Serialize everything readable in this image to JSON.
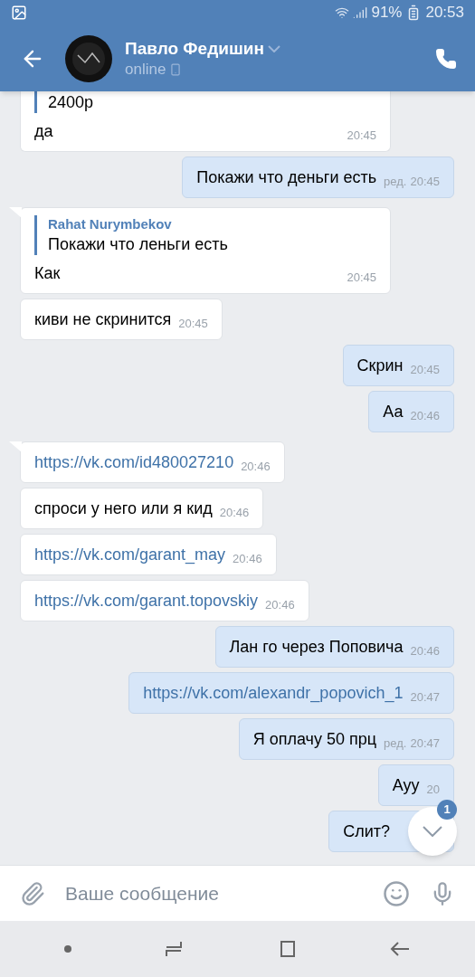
{
  "status_bar": {
    "battery": "91%",
    "time": "20:53"
  },
  "header": {
    "name": "Павло Федишин",
    "status": "online"
  },
  "messages": [
    {
      "outgoing": false,
      "tail": false,
      "quote": {
        "text": "2400р"
      },
      "kind": "text",
      "text": "да",
      "time": "20:45"
    },
    {
      "outgoing": true,
      "tail": false,
      "kind": "text",
      "text": "Покажи что деньги есть",
      "edited": "ред.",
      "time": "20:45"
    },
    {
      "outgoing": false,
      "tail": true,
      "quote": {
        "author": "Rahat Nurymbekov",
        "text": "Покажи что леньги есть"
      },
      "kind": "text",
      "text": "Как",
      "time": "20:45"
    },
    {
      "outgoing": false,
      "tail": false,
      "kind": "text",
      "text": "киви не скринится",
      "time": "20:45"
    },
    {
      "outgoing": true,
      "tail": false,
      "kind": "text",
      "text": "Скрин",
      "time": "20:45"
    },
    {
      "outgoing": true,
      "tail": false,
      "kind": "text",
      "text": "Аа",
      "time": "20:46"
    },
    {
      "outgoing": false,
      "tail": true,
      "kind": "link",
      "text": "https://vk.com/id480027210",
      "time": "20:46"
    },
    {
      "outgoing": false,
      "tail": false,
      "kind": "text",
      "text": "спроси у него или я кид",
      "time": "20:46"
    },
    {
      "outgoing": false,
      "tail": false,
      "kind": "link",
      "text": "https://vk.com/garant_may",
      "time": "20:46"
    },
    {
      "outgoing": false,
      "tail": false,
      "kind": "link",
      "text": "https://vk.com/garant.topovskiy",
      "time": "20:46"
    },
    {
      "outgoing": true,
      "tail": false,
      "kind": "text",
      "text": "Лан го через Поповича",
      "time": "20:46"
    },
    {
      "outgoing": true,
      "tail": false,
      "kind": "link",
      "text": "https://vk.com/alexandr_popovich_1",
      "time": "20:47"
    },
    {
      "outgoing": true,
      "tail": false,
      "kind": "text",
      "text": "Я оплачу 50 прц",
      "edited": "ред.",
      "time": "20:47"
    },
    {
      "outgoing": true,
      "tail": false,
      "kind": "text",
      "text": "Ауу",
      "time": "20"
    },
    {
      "outgoing": true,
      "tail": false,
      "kind": "text",
      "text": "Слит?"
    }
  ],
  "scroll_down": {
    "badge": "1"
  },
  "composer": {
    "placeholder": "Ваше сообщение"
  }
}
